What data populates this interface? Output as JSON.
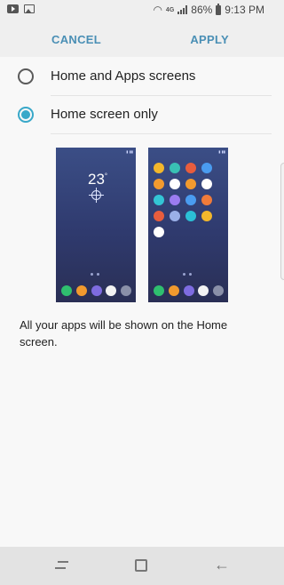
{
  "statusbar": {
    "battery": "86%",
    "time": "9:13 PM",
    "network_label": "4G",
    "icons": [
      "youtube-icon",
      "gallery-icon",
      "wifi-icon",
      "signal-icon",
      "battery-icon"
    ]
  },
  "actionbar": {
    "cancel_label": "CANCEL",
    "apply_label": "APPLY"
  },
  "options": [
    {
      "label": "Home and Apps screens",
      "selected": false
    },
    {
      "label": "Home screen only",
      "selected": true
    }
  ],
  "preview": {
    "weather_temp": "23",
    "weather_unit": "°",
    "weather_icon": "sun-icon",
    "dock_colors": [
      "#2fbf6f",
      "#f29a2e",
      "#7e6ce0",
      "#f3f3f3",
      "#8a90a8"
    ],
    "grid_colors": [
      "#f3b72c",
      "#39c1b4",
      "#e85d3d",
      "#4a9cf0",
      "#f29a2e",
      "#ffffff",
      "#f29a2e",
      "#ffffff",
      "#33c5d5",
      "#9b7cf0",
      "#4a9cf0",
      "#f07b3a",
      "#e85d3d",
      "#9ab0e8",
      "#2bc0d6",
      "#f3b72c",
      "#ffffff"
    ]
  },
  "description": "All your apps will be shown on the Home screen.",
  "colors": {
    "accent": "#39a8c9",
    "action_text": "#4a8fb5"
  },
  "navbar": {
    "icons": [
      "recent-apps-icon",
      "home-icon",
      "back-icon"
    ]
  }
}
